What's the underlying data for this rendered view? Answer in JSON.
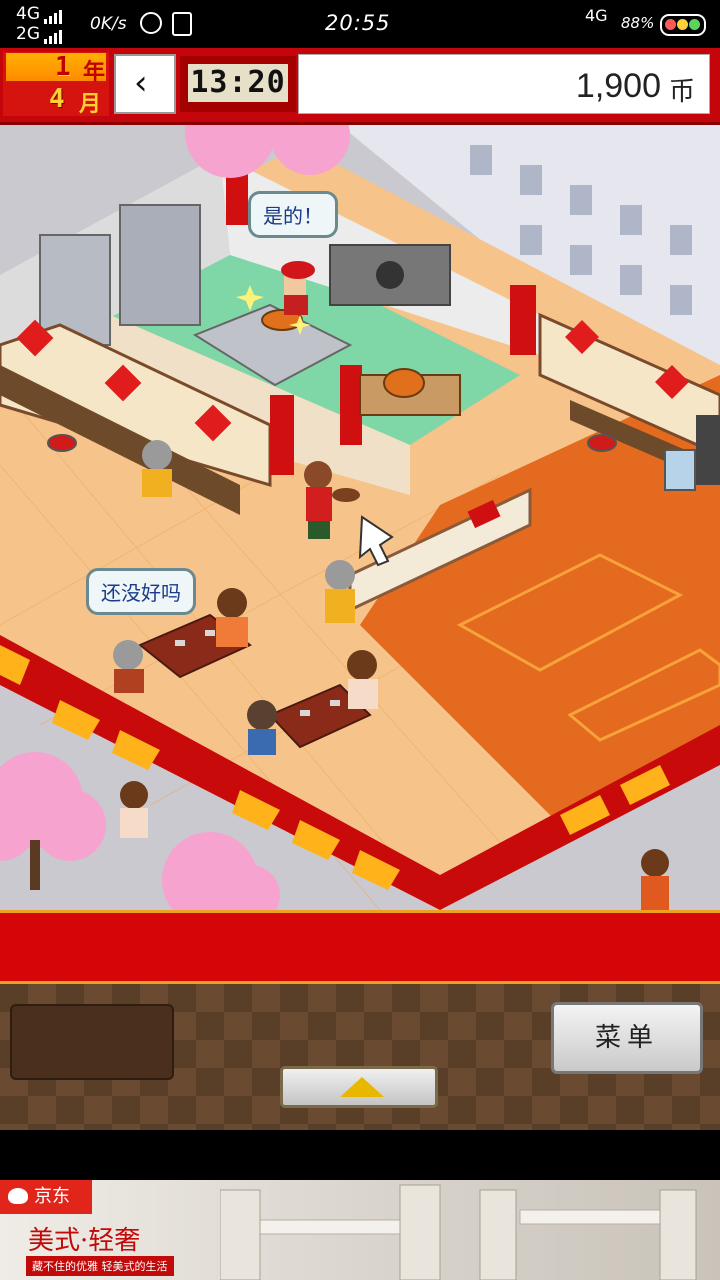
{
  "status_bar": {
    "net_top": "4G",
    "net_bottom": "2G",
    "speed": "0K/s",
    "time": "20:55",
    "net_right": "4G",
    "battery": "88%"
  },
  "hud": {
    "year_num": "1",
    "year_unit": "年",
    "month_num": "4",
    "month_unit": "月",
    "clock_time": "13:20",
    "money": "1,900",
    "currency": "币"
  },
  "bubbles": {
    "chef": "是的！",
    "customer": "还没好吗"
  },
  "bottom": {
    "menu_label": "菜单"
  },
  "ad": {
    "brand": "京东",
    "headline": "美式·轻奢",
    "tagline": "藏不住的优雅 轻美式的生活"
  },
  "colors": {
    "hud_red": "#c4060c",
    "floor": "#f6c48a",
    "carpet": "#e06a1c",
    "accent_yellow": "#f0a020"
  }
}
